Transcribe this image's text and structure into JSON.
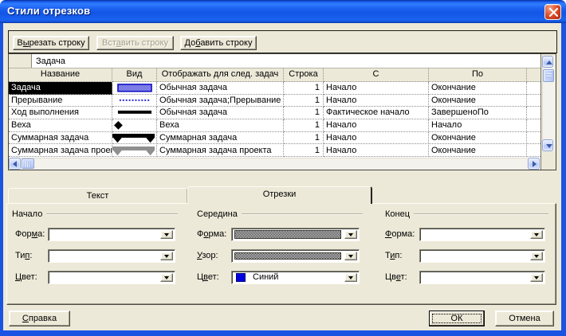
{
  "window": {
    "title": "Стили отрезков"
  },
  "toolbar": {
    "cut": {
      "pre": "В",
      "key": "ы",
      "post": "резать строку"
    },
    "insert": {
      "pre": "Вст",
      "key": "а",
      "post": "вить строку"
    },
    "add": {
      "pre": "До",
      "key": "б",
      "post": "авить строку"
    }
  },
  "entry_bar": {
    "value": "Задача"
  },
  "table": {
    "columns": {
      "name": "Название",
      "appearance": "Вид",
      "show_for": "Отображать для след. задач",
      "row": "Строка",
      "from": "С",
      "to": "По"
    },
    "rows": [
      {
        "name": "Задача",
        "appearance": "blue-hatched-bar",
        "show_for": "Обычная задача",
        "row": "1",
        "from": "Начало",
        "to": "Окончание"
      },
      {
        "name": "Прерывание",
        "appearance": "blue-dotted-line",
        "show_for": "Обычная задача;Прерывание",
        "row": "1",
        "from": "Начало",
        "to": "Окончание"
      },
      {
        "name": "Ход выполнения",
        "appearance": "black-solid-bar",
        "show_for": "Обычная задача",
        "row": "1",
        "from": "Фактическое начало",
        "to": "ЗавершеноПо"
      },
      {
        "name": "Веха",
        "appearance": "black-diamond",
        "show_for": "Веха",
        "row": "1",
        "from": "Начало",
        "to": "Начало"
      },
      {
        "name": "Суммарная задача",
        "appearance": "black-summary-bar",
        "show_for": "Суммарная задача",
        "row": "1",
        "from": "Начало",
        "to": "Окончание"
      },
      {
        "name": "Суммарная задача проекта",
        "appearance": "gray-summary-bar",
        "show_for": "Суммарная задача проекта",
        "row": "1",
        "from": "Начало",
        "to": "Окончание"
      }
    ],
    "selected_row": "Задача"
  },
  "tabs": {
    "text": "Текст",
    "bars": "Отрезки",
    "active": "Отрезки"
  },
  "sections": {
    "start": {
      "title": "Начало",
      "shape_label": {
        "pre": "Фор",
        "key": "м",
        "post": "а:"
      },
      "type_label": {
        "pre": "Ти",
        "key": "п",
        "post": ":"
      },
      "color_label": {
        "pre": "",
        "key": "Ц",
        "post": "вет:"
      },
      "shape_value": "",
      "type_value": "",
      "color_value": ""
    },
    "middle": {
      "title": "Середина",
      "shape_label": {
        "pre": "Ф",
        "key": "о",
        "post": "рма:"
      },
      "pattern_label": {
        "pre": "",
        "key": "У",
        "post": "зор:"
      },
      "color_label": {
        "pre": "Ц",
        "key": "в",
        "post": "ет:"
      },
      "shape_value": "hatched-bar",
      "pattern_value": "hatched",
      "color_value": "Синий",
      "color_swatch": "#0000e0"
    },
    "end": {
      "title": "Конец",
      "shape_label": {
        "pre": "",
        "key": "Ф",
        "post": "орма:"
      },
      "type_label": {
        "pre": "Т",
        "key": "и",
        "post": "п:"
      },
      "color_label": {
        "pre": "Цв",
        "key": "е",
        "post": "т:"
      },
      "shape_value": "",
      "type_value": "",
      "color_value": ""
    }
  },
  "footer": {
    "help": {
      "pre": "",
      "key": "С",
      "post": "правка"
    },
    "ok": "ОК",
    "cancel": "Отмена"
  },
  "colors": {
    "dialog_bg": "#ece9d8",
    "titlebar_blue": "#1356e6",
    "frame_blue": "#1b54e2",
    "close_red": "#cc3a18",
    "selection_bg": "#000000",
    "selection_fg": "#ffffff",
    "task_bar_blue": "#2222cc",
    "scrollbar_blue": "#c4d3f8"
  }
}
